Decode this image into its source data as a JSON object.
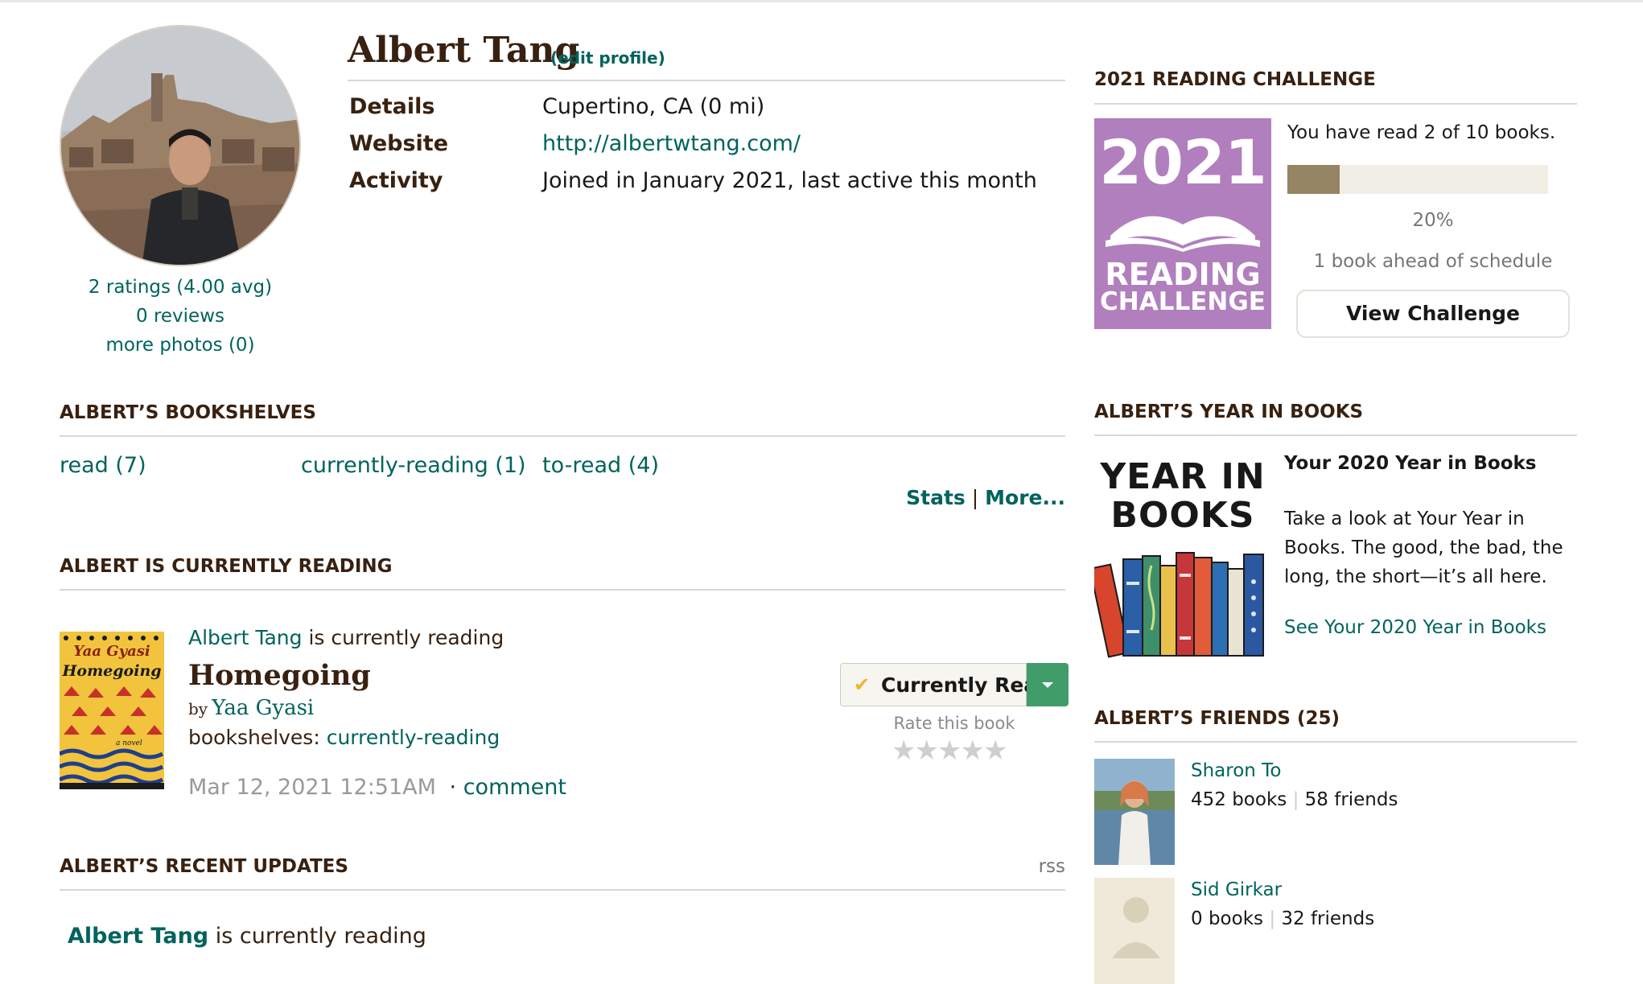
{
  "profile": {
    "name": "Albert Tang",
    "edit_label": "(edit profile)",
    "ratings_link": "2 ratings (4.00 avg)",
    "reviews_link": "0 reviews",
    "photos_link": "more photos (0)",
    "details_label": "Details",
    "details_value": "Cupertino, CA (0 mi)",
    "website_label": "Website",
    "website_value": "http://albertwtang.com/",
    "activity_label": "Activity",
    "activity_value": "Joined in January 2021, last active this month"
  },
  "bookshelves": {
    "heading": "ALBERT’S BOOKSHELVES",
    "items": [
      {
        "label": "read (7)"
      },
      {
        "label": "currently-reading (1)"
      },
      {
        "label": "to-read (4)"
      }
    ],
    "stats_label": "Stats",
    "separator": "|",
    "more_label": "More..."
  },
  "currently_reading": {
    "heading": "ALBERT IS CURRENTLY READING",
    "user_link": "Albert Tang",
    "verb": "is currently reading",
    "book_title": "Homegoing",
    "by_label": "by",
    "author": "Yaa Gyasi",
    "shelves_label": "bookshelves:",
    "shelf_link": "currently-reading",
    "timestamp": "Mar 12, 2021 12:51AM",
    "dot": "·",
    "comment_link": "comment",
    "cover_text": {
      "author": "Yaa Gyasi",
      "title": "Homegoing",
      "sub": "a novel"
    },
    "status_button": "Currently Rea...",
    "rate_label": "Rate this book",
    "rating": 0,
    "max_rating": 5
  },
  "recent_updates": {
    "heading": "ALBERT’S RECENT UPDATES",
    "rss_label": "rss",
    "first_user": "Albert Tang",
    "first_verb": "is currently reading"
  },
  "challenge": {
    "heading": "2021 READING CHALLENGE",
    "badge_year": "2021",
    "badge_line1": "READING",
    "badge_line2": "CHALLENGE",
    "progress_text": "You have read 2 of 10 books.",
    "progress_fraction": 0.2,
    "percent_label": "20%",
    "schedule_text": "1 book ahead of schedule",
    "button_label": "View Challenge"
  },
  "year_in_books": {
    "heading": "ALBERT’S YEAR IN BOOKS",
    "graphic_line1": "YEAR IN",
    "graphic_line2": "BOOKS",
    "title": "Your 2020 Year in Books",
    "body": "Take a look at Your Year in Books. The good, the bad, the long, the short—it’s all here.",
    "link": "See Your 2020 Year in Books"
  },
  "friends": {
    "heading": "ALBERT’S FRIENDS (25)",
    "list": [
      {
        "name": "Sharon To",
        "books": "452 books",
        "friends": "58 friends"
      },
      {
        "name": "Sid Girkar",
        "books": "0 books",
        "friends": "32 friends"
      }
    ],
    "separator": "|"
  },
  "colors": {
    "link": "#00635d",
    "heading": "#382110",
    "challenge_purple": "#b17fbe",
    "progress_fill": "#958565",
    "dropdown_green": "#409d69"
  }
}
